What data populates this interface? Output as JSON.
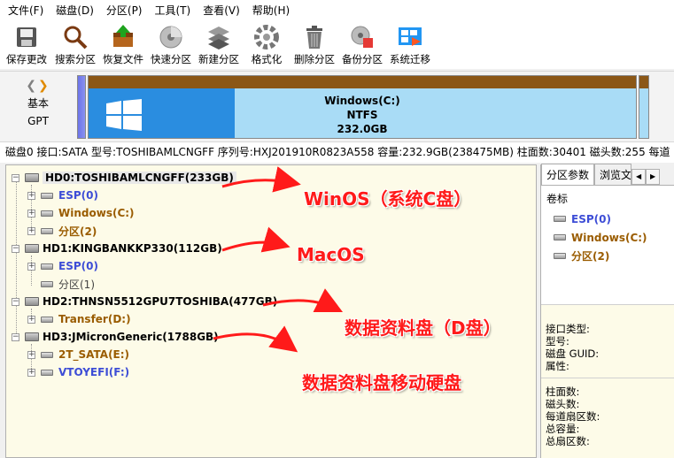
{
  "menu": [
    "文件(F)",
    "磁盘(D)",
    "分区(P)",
    "工具(T)",
    "查看(V)",
    "帮助(H)"
  ],
  "toolbar": [
    {
      "label": "保存更改",
      "icon": "save-icon"
    },
    {
      "label": "搜索分区",
      "icon": "search-icon"
    },
    {
      "label": "恢复文件",
      "icon": "restore-file-icon"
    },
    {
      "label": "快速分区",
      "icon": "quick-partition-icon"
    },
    {
      "label": "新建分区",
      "icon": "new-partition-icon"
    },
    {
      "label": "格式化",
      "icon": "format-icon"
    },
    {
      "label": "删除分区",
      "icon": "delete-icon"
    },
    {
      "label": "备份分区",
      "icon": "backup-icon"
    },
    {
      "label": "系统迁移",
      "icon": "migrate-icon"
    }
  ],
  "diskmap": {
    "type_line1": "基本",
    "type_line2": "GPT",
    "partition_name": "Windows(C:)",
    "partition_fs": "NTFS",
    "partition_size": "232.0GB"
  },
  "infobar": "磁盘0 接口:SATA  型号:TOSHIBAMLCNGFF  序列号:HXJ201910R0823A558  容量:232.9GB(238475MB)  柱面数:30401  磁头数:255  每道",
  "tree": {
    "hd0": "HD0:TOSHIBAMLCNGFF(233GB)",
    "hd0_esp": "ESP(0)",
    "hd0_win": "Windows(C:)",
    "hd0_p2": "分区(2)",
    "hd1": "HD1:KINGBANKKP330(112GB)",
    "hd1_esp": "ESP(0)",
    "hd1_p1": "分区(1)",
    "hd2": "HD2:THNSN5512GPU7TOSHIBA(477GB)",
    "hd2_transfer": "Transfer(D:)",
    "hd3": "HD3:JMicronGeneric(1788GB)",
    "hd3_sata": "2T_SATA(E:)",
    "hd3_vtoyefi": "VTOYEFI(F:)"
  },
  "annotations": {
    "a1": "WinOS（系统C盘）",
    "a2": "MacOS",
    "a3": "数据资料盘（D盘）",
    "a4": "数据资料盘移动硬盘"
  },
  "right_panel": {
    "tab1": "分区参数",
    "tab2": "浏览文",
    "heading": "卷标",
    "vols": [
      "ESP(0)",
      "Windows(C:)",
      "分区(2)"
    ],
    "fields1": [
      "接口类型:",
      "型号:",
      "磁盘 GUID:",
      "属性:"
    ],
    "fields2": [
      "柱面数:",
      "磁头数:",
      "每道扇区数:",
      "总容量:",
      "总扇区数:"
    ]
  },
  "colors": {
    "annotation": "#ff1a1a",
    "esp_blue": "#3d4dd6",
    "vol_brown": "#9a5c00",
    "partition_fill": "#2a8de0"
  }
}
